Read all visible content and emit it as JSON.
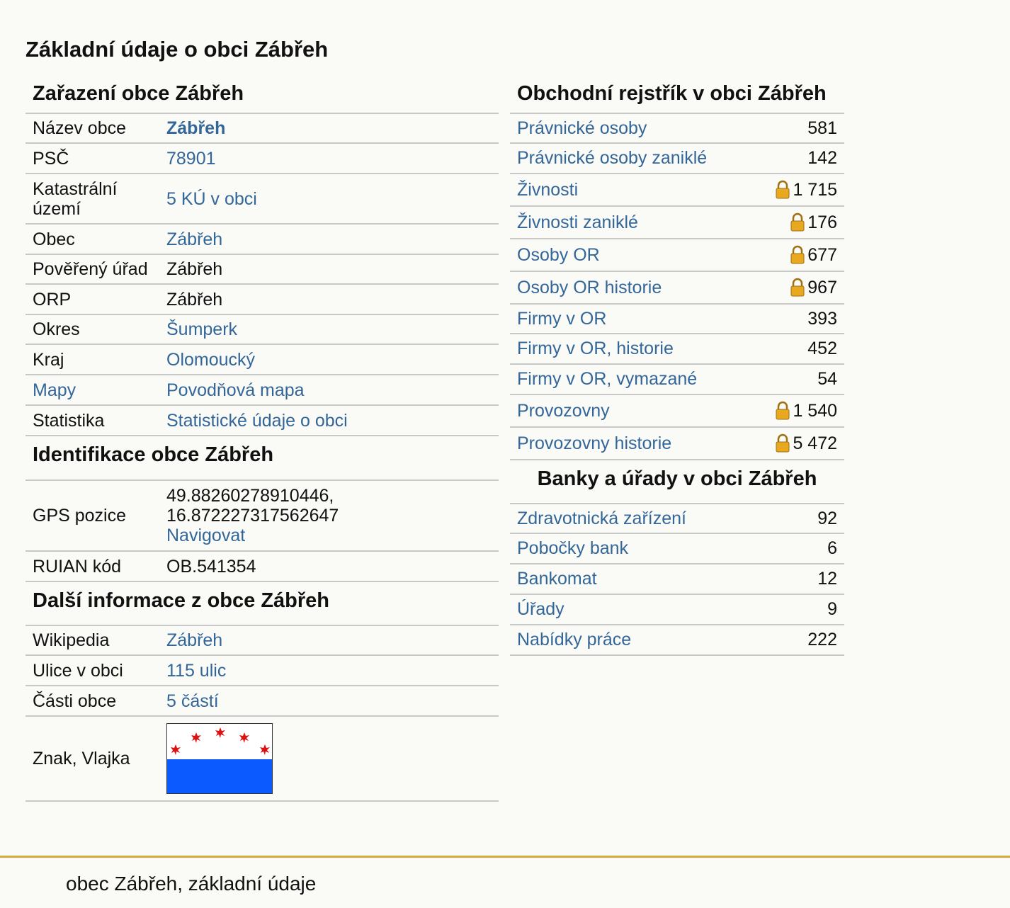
{
  "page_title": "Základní údaje o obci Zábřeh",
  "zarazeni": {
    "title": "Zařazení obce Zábřeh",
    "rows": [
      {
        "label": "Název obce",
        "value": "Zábřeh"
      },
      {
        "label": "PSČ",
        "value": "78901"
      },
      {
        "label": "Katastrální území",
        "value": "5 KÚ v obci"
      },
      {
        "label": "Obec",
        "value": "Zábřeh"
      },
      {
        "label": "Pověřený úřad",
        "value": "Zábřeh"
      },
      {
        "label": "ORP",
        "value": "Zábřeh"
      },
      {
        "label": "Okres",
        "value": "Šumperk"
      },
      {
        "label": "Kraj",
        "value": "Olomoucký"
      },
      {
        "label": "Mapy",
        "value": "Povodňová mapa"
      },
      {
        "label": "Statistika",
        "value": "Statistické údaje o obci"
      }
    ]
  },
  "identifikace": {
    "title": "Identifikace obce Zábřeh",
    "gps_label": "GPS pozice",
    "gps_lat": "49.88260278910446,",
    "gps_lon": "16.872227317562647",
    "gps_nav": "Navigovat",
    "ruian_label": "RUIAN kód",
    "ruian_value": "OB.541354"
  },
  "dalsi": {
    "title": "Další informace z obce Zábřeh",
    "rows": [
      {
        "label": "Wikipedia",
        "value": "Zábřeh"
      },
      {
        "label": "Ulice v obci",
        "value": "115 ulic"
      },
      {
        "label": "Části obce",
        "value": "5 částí"
      }
    ],
    "flag_label": "Znak, Vlajka",
    "flag_colors": {
      "top": "#ffffff",
      "bottom": "#0a5aff",
      "stars": "#dd1111"
    }
  },
  "rejstrik": {
    "title": "Obchodní rejstřík v obci Zábřeh",
    "rows": [
      {
        "label": "Právnické osoby",
        "value": "581",
        "locked": false
      },
      {
        "label": "Právnické osoby zaniklé",
        "value": "142",
        "locked": false
      },
      {
        "label": "Živnosti",
        "value": "1 715",
        "locked": true
      },
      {
        "label": "Živnosti zaniklé",
        "value": "176",
        "locked": true
      },
      {
        "label": "Osoby OR",
        "value": "677",
        "locked": true
      },
      {
        "label": "Osoby OR historie",
        "value": "967",
        "locked": true
      },
      {
        "label": "Firmy v OR",
        "value": "393",
        "locked": false
      },
      {
        "label": "Firmy v OR, historie",
        "value": "452",
        "locked": false
      },
      {
        "label": "Firmy v OR, vymazané",
        "value": "54",
        "locked": false
      },
      {
        "label": "Provozovny",
        "value": "1 540",
        "locked": true
      },
      {
        "label": "Provozovny historie",
        "value": "5 472",
        "locked": true
      }
    ]
  },
  "banky": {
    "title": "Banky a úřady v obci Zábřeh",
    "rows": [
      {
        "label": "Zdravotnická zařízení",
        "value": "92"
      },
      {
        "label": "Pobočky bank",
        "value": "6"
      },
      {
        "label": "Bankomat",
        "value": "12"
      },
      {
        "label": "Úřady",
        "value": "9"
      },
      {
        "label": "Nabídky práce",
        "value": "222"
      }
    ]
  },
  "footer_text": "obec Zábřeh, základní údaje",
  "colors": {
    "link": "#336699",
    "border": "#c8c8c8",
    "footer_line": "#d4aa3a",
    "lock": "#e8a820"
  }
}
